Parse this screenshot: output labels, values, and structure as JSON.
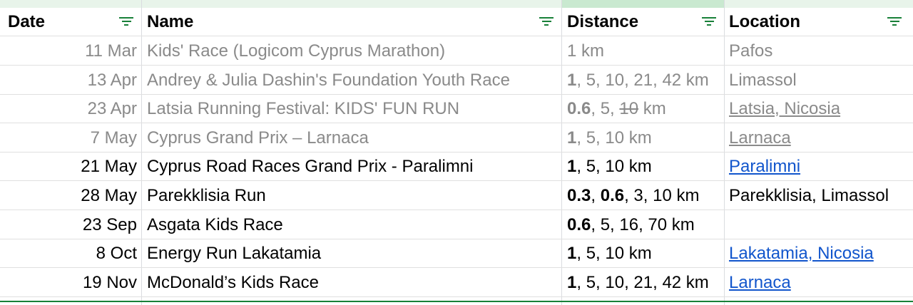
{
  "header": {
    "date": "Date",
    "name": "Name",
    "distance": "Distance",
    "location": "Location"
  },
  "rows": [
    {
      "date": "11 Mar",
      "name": "Kids' Race (Logicom Cyprus Marathon)",
      "distance": [
        [
          "1 km",
          false
        ]
      ],
      "location": "Pafos",
      "past": true,
      "loc_link": false
    },
    {
      "date": "13 Apr",
      "name": "Andrey & Julia Dashin's Foundation Youth Race",
      "distance": [
        [
          "1",
          true
        ],
        [
          ", 5, 10, 21, 42 km",
          false
        ]
      ],
      "location": "Limassol",
      "past": true,
      "loc_link": false
    },
    {
      "date": "23 Apr",
      "name": "Latsia Running Festival: KIDS' FUN RUN",
      "distance": [
        [
          "0.6",
          true
        ],
        [
          ", 5, ",
          false
        ],
        [
          "10",
          false,
          true
        ],
        [
          " km",
          false
        ]
      ],
      "location": "Latsia, Nicosia",
      "past": true,
      "loc_link": true
    },
    {
      "date": "7 May",
      "name": "Cyprus Grand Prix – Larnaca",
      "distance": [
        [
          "1",
          true
        ],
        [
          ", 5, 10 km",
          false
        ]
      ],
      "location": "Larnaca",
      "past": true,
      "loc_link": true
    },
    {
      "date": "21 May",
      "name": "Cyprus Road Races Grand Prix - Paralimni",
      "distance": [
        [
          "1",
          true
        ],
        [
          ", 5, 10 km",
          false
        ]
      ],
      "location": "Paralimni",
      "past": false,
      "loc_link": true
    },
    {
      "date": "28 May",
      "name": "Parekklisia Run",
      "distance": [
        [
          "0.3",
          true
        ],
        [
          ", ",
          false
        ],
        [
          "0.6",
          true
        ],
        [
          ", 3, 10 km",
          false
        ]
      ],
      "location": "Parekklisia, Limassol",
      "past": false,
      "loc_link": false
    },
    {
      "date": "23 Sep",
      "name": "Asgata Kids Race",
      "distance": [
        [
          "0.6",
          true
        ],
        [
          ", 5, 16, 70 km",
          false
        ]
      ],
      "location": "",
      "past": false,
      "loc_link": false
    },
    {
      "date": "8 Oct",
      "name": "Energy Run Lakatamia",
      "distance": [
        [
          "1",
          true
        ],
        [
          ", 5, 10 km",
          false
        ]
      ],
      "location": "Lakatamia, Nicosia",
      "past": false,
      "loc_link": true
    },
    {
      "date": "19 Nov",
      "name": "McDonald’s Kids Race",
      "distance": [
        [
          "1",
          true
        ],
        [
          ", 5, 10, 21, 42 km",
          false
        ]
      ],
      "location": "Larnaca",
      "past": false,
      "loc_link": true
    }
  ],
  "colors": {
    "header_strip": "#e8f4ea",
    "filter_green": "#188038",
    "past_text": "#8a8a8a",
    "link": "#1155cc"
  },
  "icons": {
    "filter": "filter-icon"
  }
}
